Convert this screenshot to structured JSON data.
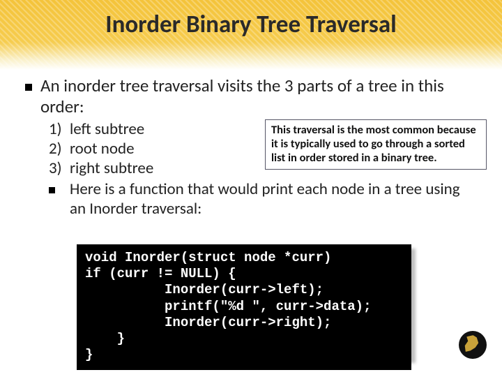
{
  "title": "Inorder Binary Tree Traversal",
  "intro": "An inorder tree traversal visits the 3 parts of a tree in this order:",
  "steps": {
    "n1": "1)",
    "t1": "left subtree",
    "n2": "2)",
    "t2": "root node",
    "n3": "3)",
    "t3": "right subtree"
  },
  "callout": "This traversal is the most common because it is typically used to go through a sorted list in order stored in a binary tree.",
  "note": "Here is a function that would print each node in a tree using an Inorder traversal:",
  "code": "void Inorder(struct node *curr)\nif (curr != NULL) {\n          Inorder(curr->left);\n          printf(\"%d \", curr->data);\n          Inorder(curr->right);\n    }\n}"
}
